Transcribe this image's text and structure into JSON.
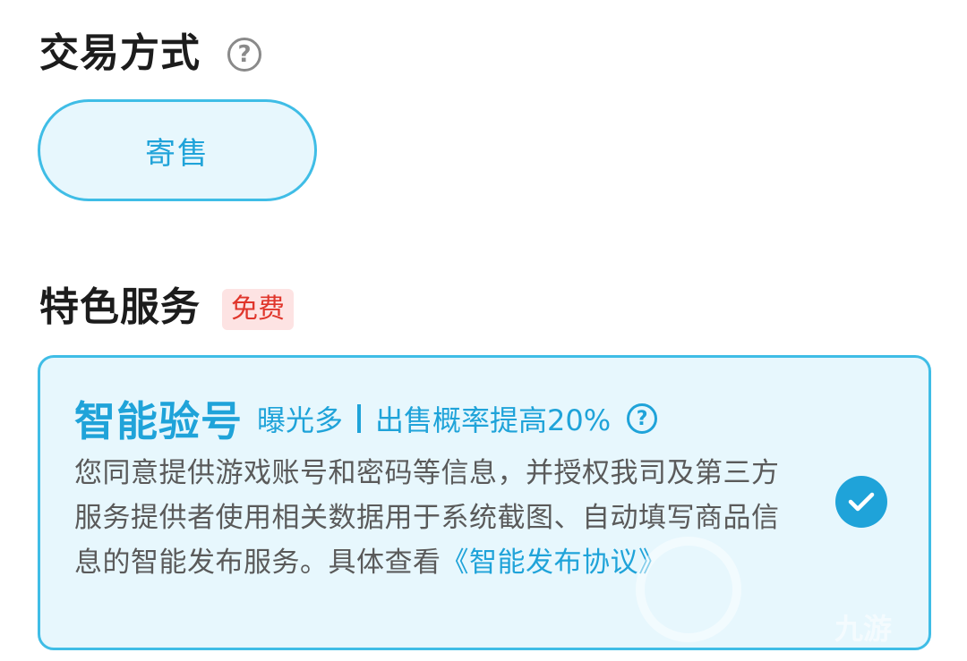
{
  "trade": {
    "title": "交易方式",
    "help_icon": "question-circle-icon",
    "help_glyph": "?",
    "option_label": "寄售"
  },
  "special": {
    "title": "特色服务",
    "badge": "免费"
  },
  "service_card": {
    "title": "智能验号",
    "sub_left": "曝光多",
    "sub_right": "出售概率提高20%",
    "help_glyph": "?",
    "description": "您同意提供游戏账号和密码等信息，并授权我司及第三方服务提供者使用相关数据用于系统截图、自动填写商品信息的智能发布服务。具体查看",
    "link": "《智能发布协议》",
    "checked": true
  },
  "watermark": {
    "text": "九游"
  },
  "colors": {
    "accent": "#1fa3d9",
    "accent_border": "#3fbde6",
    "accent_bg": "#e7f7fd",
    "badge_bg": "#fde3e3",
    "badge_text": "#e0352b"
  }
}
